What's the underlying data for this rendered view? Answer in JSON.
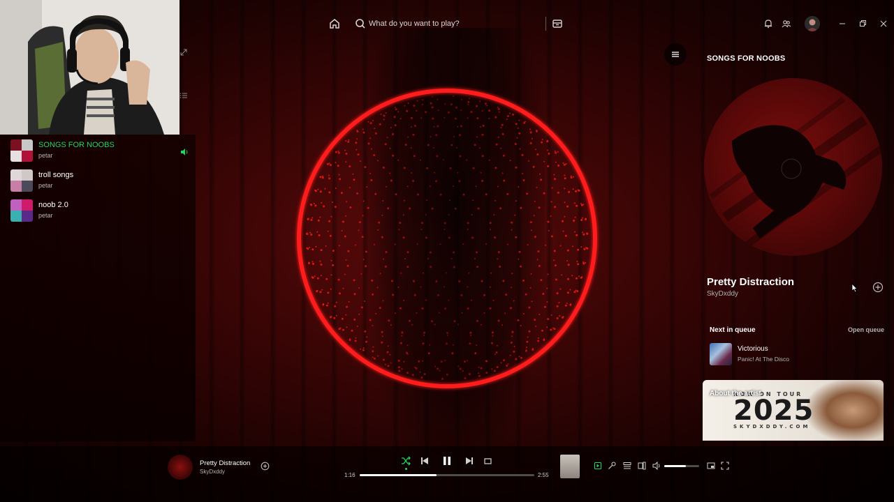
{
  "colors": {
    "accent": "#1ed760",
    "visualizer": "#ff1a1a",
    "background": "#2a0404"
  },
  "topbar": {
    "home_icon": "home-icon",
    "search_placeholder": "What do you want to play?",
    "browse_icon": "browse-icon",
    "bell_icon": "bell-icon",
    "friends_icon": "friends-icon",
    "avatar_icon": "avatar-icon",
    "window_controls": [
      "minimize-icon",
      "restore-icon",
      "close-icon"
    ]
  },
  "sidebar": {
    "playlists": [
      {
        "title": "SONGS FOR NOOBS",
        "owner": "petar",
        "playing": true
      },
      {
        "title": "troll songs",
        "owner": "petar",
        "playing": false
      },
      {
        "title": "noob 2.0",
        "owner": "petar",
        "playing": false
      }
    ]
  },
  "right_panel": {
    "context_title": "SONGS FOR NOOBS",
    "now_playing": {
      "title": "Pretty Distraction",
      "artist": "SkyDxddy"
    },
    "queue": {
      "heading": "Next in queue",
      "open_label": "Open queue",
      "next": {
        "title": "Victorious",
        "artist": "Panic! At The Disco"
      }
    },
    "about": {
      "label": "About the artist",
      "poster_top": "NOW ON TOUR",
      "poster_year": "2025",
      "poster_url": "SKYDXDDY.COM"
    }
  },
  "player": {
    "track": {
      "title": "Pretty Distraction",
      "artist": "SkyDxddy"
    },
    "time_current": "1:16",
    "time_total": "2:55",
    "progress": 0.44,
    "volume": 0.62,
    "shuffle_on": true
  }
}
